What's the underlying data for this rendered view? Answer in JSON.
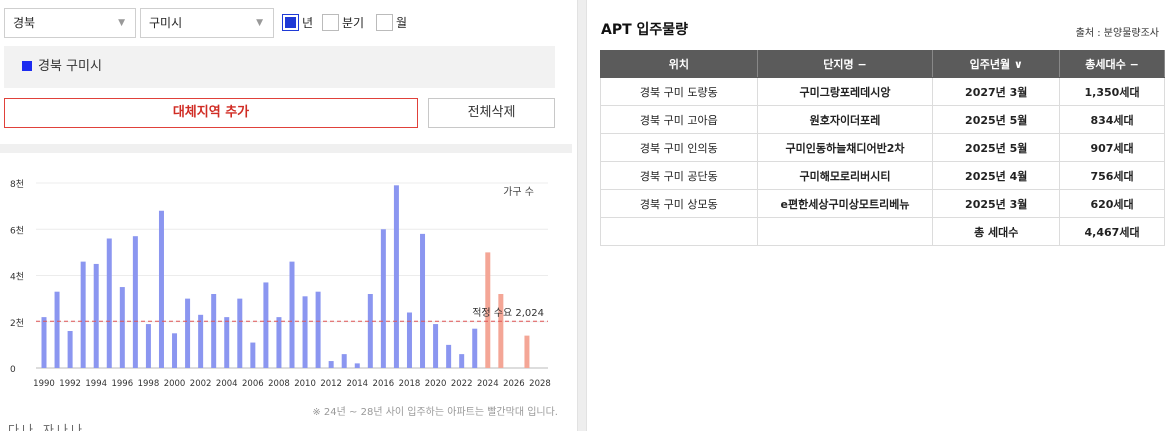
{
  "filters": {
    "province": "경북",
    "city": "구미시",
    "period_options": [
      {
        "label": "년",
        "checked": true
      },
      {
        "label": "분기",
        "checked": false
      },
      {
        "label": "월",
        "checked": false
      }
    ]
  },
  "selected_region": "경북 구미시",
  "buttons": {
    "add_region": "대체지역 추가",
    "clear_all": "전체삭제"
  },
  "chart_data": {
    "type": "bar",
    "legend_label": "가구 수",
    "y_ticks": [
      "0",
      "2천",
      "4천",
      "6천",
      "8천"
    ],
    "ylim": [
      0,
      8000
    ],
    "x": [
      1990,
      1991,
      1992,
      1993,
      1994,
      1995,
      1996,
      1997,
      1998,
      1999,
      2000,
      2001,
      2002,
      2003,
      2004,
      2005,
      2006,
      2007,
      2008,
      2009,
      2010,
      2011,
      2012,
      2013,
      2014,
      2015,
      2016,
      2017,
      2018,
      2019,
      2020,
      2021,
      2022,
      2023,
      2024,
      2025,
      2026,
      2027
    ],
    "values": [
      2200,
      3300,
      1600,
      4600,
      4500,
      5600,
      3500,
      5700,
      1900,
      6800,
      1500,
      3000,
      2300,
      3200,
      2200,
      3000,
      1100,
      3700,
      2200,
      4600,
      3100,
      3300,
      300,
      600,
      200,
      3200,
      6000,
      7900,
      2400,
      5800,
      1900,
      1000,
      600,
      1700,
      5000,
      3200,
      0,
      1400
    ],
    "future_from": 2024,
    "x_tick_labels": [
      "1990",
      "1992",
      "1994",
      "1996",
      "1998",
      "2000",
      "2002",
      "2004",
      "2006",
      "2008",
      "2010",
      "2012",
      "2014",
      "2016",
      "2018",
      "2020",
      "2022",
      "2024",
      "2026",
      "2028"
    ],
    "x_tick_years": [
      1990,
      1992,
      1994,
      1996,
      1998,
      2000,
      2002,
      2004,
      2006,
      2008,
      2010,
      2012,
      2014,
      2016,
      2018,
      2020,
      2022,
      2024,
      2026,
      2028
    ],
    "reference_line": {
      "label": "적정 수요 2,024",
      "value": 2024
    },
    "colors": {
      "past": "#8b96f0",
      "future": "#f4a696",
      "ref": "#e05555"
    },
    "note": "※ 24년 ~ 28년 사이 입주하는 아파트는 빨간막대 입니다."
  },
  "apt_supply": {
    "title": "APT 입주물량",
    "source": "출처 : 분양물량조사",
    "columns": [
      "위치",
      "단지명 −",
      "입주년월 ∨",
      "총세대수 −"
    ],
    "rows": [
      {
        "location": "경북 구미 도량동",
        "complex": "구미그랑포레데시앙",
        "move_in": "2027년 3월",
        "units": "1,350세대"
      },
      {
        "location": "경북 구미 고아읍",
        "complex": "원호자이더포레",
        "move_in": "2025년 5월",
        "units": "834세대"
      },
      {
        "location": "경북 구미 인의동",
        "complex": "구미인동하늘채디어반2차",
        "move_in": "2025년 5월",
        "units": "907세대"
      },
      {
        "location": "경북 구미 공단동",
        "complex": "구미해모로리버시티",
        "move_in": "2025년 4월",
        "units": "756세대"
      },
      {
        "location": "경북 구미 상모동",
        "complex": "e편한세상구미상모트리베뉴",
        "move_in": "2025년 3월",
        "units": "620세대"
      }
    ],
    "total_label": "총 세대수",
    "total_value": "4,467세대"
  },
  "cut_text": "다나 자나나"
}
